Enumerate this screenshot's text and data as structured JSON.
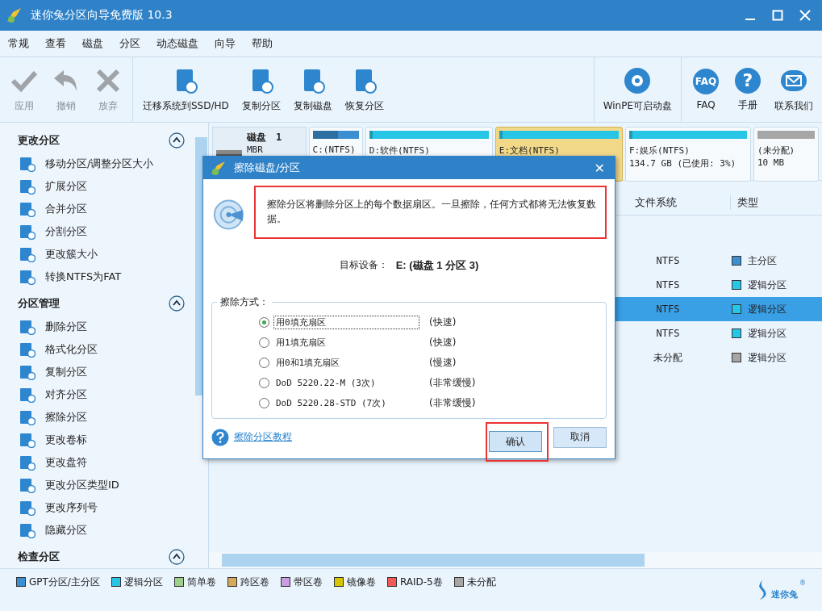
{
  "window": {
    "title": "迷你兔分区向导免费版 10.3"
  },
  "menu": [
    "常规",
    "查看",
    "磁盘",
    "分区",
    "动态磁盘",
    "向导",
    "帮助"
  ],
  "toolbar_groups": [
    [
      {
        "label": "应用",
        "disabled": true
      },
      {
        "label": "撤销",
        "disabled": true
      },
      {
        "label": "放弃",
        "disabled": true
      }
    ],
    [
      {
        "label": "迁移系统到SSD/HD",
        "disabled": false
      },
      {
        "label": "复制分区",
        "disabled": false
      },
      {
        "label": "复制磁盘",
        "disabled": false
      },
      {
        "label": "恢复分区",
        "disabled": false
      }
    ],
    [
      {
        "label": "WinPE可启动盘",
        "disabled": false
      }
    ],
    [
      {
        "label": "FAQ",
        "disabled": false,
        "badge": "FAQ"
      },
      {
        "label": "手册",
        "disabled": false,
        "badge": "?"
      },
      {
        "label": "联系我们",
        "disabled": false
      }
    ]
  ],
  "sidebar": [
    {
      "title": "更改分区",
      "expanded": true,
      "items": [
        "移动分区/调整分区大小",
        "扩展分区",
        "合并分区",
        "分割分区",
        "更改簇大小",
        "转换NTFS为FAT"
      ]
    },
    {
      "title": "分区管理",
      "expanded": true,
      "items": [
        "删除分区",
        "格式化分区",
        "复制分区",
        "对齐分区",
        "擦除分区",
        "更改卷标",
        "更改盘符",
        "更改分区类型ID",
        "更改序列号",
        "隐藏分区"
      ]
    },
    {
      "title": "检查分区",
      "expanded": true
    }
  ],
  "disk": {
    "name": "磁盘　1",
    "scheme": "MBR",
    "partitions": [
      {
        "label": "C:(NTFS)",
        "color": "#3b8fd0",
        "level": 0.55,
        "selected": false
      },
      {
        "label": "D:软件(NTFS)",
        "color": "#27c5e6",
        "level": 0.03,
        "selected": false
      },
      {
        "label": "E:文档(NTFS)",
        "color": "#27c5e6",
        "level": 0.03,
        "selected": true
      },
      {
        "label": "F:娱乐(NTFS)",
        "detail": "134.7 GB (已使用: 3%)",
        "color": "#27c5e6",
        "level": 0.03,
        "selected": false
      },
      {
        "label": "(未分配)",
        "detail": "10 MB",
        "color": "#a6a6a6",
        "selected": false
      }
    ]
  },
  "table": {
    "columns": [
      "文件系统",
      "类型"
    ],
    "rows": [
      {
        "file_system": "NTFS",
        "type": "主分区",
        "color": "#3b8fd0",
        "selected": false
      },
      {
        "file_system": "NTFS",
        "type": "逻辑分区",
        "color": "#27c5e6",
        "selected": false
      },
      {
        "file_system": "NTFS",
        "type": "逻辑分区",
        "color": "#27c5e6",
        "selected": true
      },
      {
        "file_system": "NTFS",
        "type": "逻辑分区",
        "color": "#27c5e6",
        "selected": false
      },
      {
        "file_system": "未分配",
        "type": "逻辑分区",
        "color": "#a6a6a6",
        "selected": false
      }
    ]
  },
  "legend": [
    {
      "label": "GPT分区/主分区",
      "color": "#3b8fd0"
    },
    {
      "label": "逻辑分区",
      "color": "#27c5e6"
    },
    {
      "label": "简单卷",
      "color": "#9fd08a"
    },
    {
      "label": "跨区卷",
      "color": "#d4a95c"
    },
    {
      "label": "带区卷",
      "color": "#c89ee0"
    },
    {
      "label": "镜像卷",
      "color": "#d8c400"
    },
    {
      "label": "RAID-5卷",
      "color": "#f05a5a"
    },
    {
      "label": "未分配",
      "color": "#a6a6a6"
    }
  ],
  "logo": {
    "text": "迷你兔",
    "mark": "®"
  },
  "dialog": {
    "title": "擦除磁盘/分区",
    "close": "✕",
    "message": "擦除分区将删除分区上的每个数据扇区。一旦擦除，任何方式都将无法恢复数据。",
    "target_label": "目标设备：",
    "target_value": "E: (磁盘 1 分区 3)",
    "group_label": "擦除方式：",
    "options": [
      {
        "label": "用0填充扇区",
        "speed": "(快速)",
        "selected": true
      },
      {
        "label": "用1填充扇区",
        "speed": "(快速)",
        "selected": false
      },
      {
        "label": "用0和1填充扇区",
        "speed": "(慢速)",
        "selected": false
      },
      {
        "label": "DoD 5220.22-M (3次)",
        "speed": "(非常缓慢)",
        "selected": false
      },
      {
        "label": "DoD 5220.28-STD (7次)",
        "speed": "(非常缓慢)",
        "selected": false
      }
    ],
    "help_link": "擦除分区教程",
    "buttons": [
      {
        "label": "确认",
        "focused": true
      },
      {
        "label": "取消",
        "focused": false
      }
    ]
  }
}
